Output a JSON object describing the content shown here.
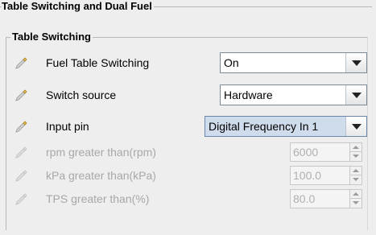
{
  "panel": {
    "title": "Table Switching and Dual Fuel",
    "section_title": "Table Switching"
  },
  "rows": [
    {
      "label": "Fuel Table Switching",
      "control": "dropdown",
      "value": "On",
      "enabled": true,
      "icon": "pencil-icon"
    },
    {
      "label": "Switch source",
      "control": "dropdown",
      "value": "Hardware",
      "enabled": true,
      "icon": "pencil-icon"
    },
    {
      "label": "Input pin",
      "control": "dropdown",
      "value": "Digital Frequency In 1",
      "enabled": true,
      "icon": "pencil-icon"
    },
    {
      "label": "rpm greater than(rpm)",
      "control": "spinner",
      "value": "6000",
      "enabled": false,
      "icon": "pencil-icon"
    },
    {
      "label": "kPa greater than(kPa)",
      "control": "spinner",
      "value": "100.0",
      "enabled": false,
      "icon": "pencil-icon"
    },
    {
      "label": "TPS greater than(%)",
      "control": "spinner",
      "value": "80.0",
      "enabled": false,
      "icon": "pencil-icon"
    }
  ],
  "colors": {
    "background": "#eeeeee",
    "combo_highlight": "#cfdceb",
    "disabled_text": "#a8a8a8"
  }
}
